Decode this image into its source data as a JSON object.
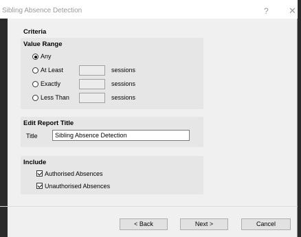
{
  "window": {
    "title": "Sibling Absence Detection",
    "help_label": "?",
    "close_label": "✕"
  },
  "criteria": {
    "heading": "Criteria"
  },
  "value_range": {
    "heading": "Value Range",
    "options": [
      {
        "label": "Any",
        "checked": true
      },
      {
        "label": "At Least",
        "checked": false,
        "unit": "sessions"
      },
      {
        "label": "Exactly",
        "checked": false,
        "unit": "sessions"
      },
      {
        "label": "Less Than",
        "checked": false,
        "unit": "sessions"
      }
    ]
  },
  "report_title": {
    "heading": "Edit Report Title",
    "label": "Title",
    "value": "Sibling Absence Detection"
  },
  "include": {
    "heading": "Include",
    "items": [
      {
        "label": "Authorised Absences",
        "checked": true
      },
      {
        "label": "Unauthorised Absences",
        "checked": true
      }
    ]
  },
  "buttons": {
    "back": "< Back",
    "next": "Next >",
    "cancel": "Cancel"
  }
}
